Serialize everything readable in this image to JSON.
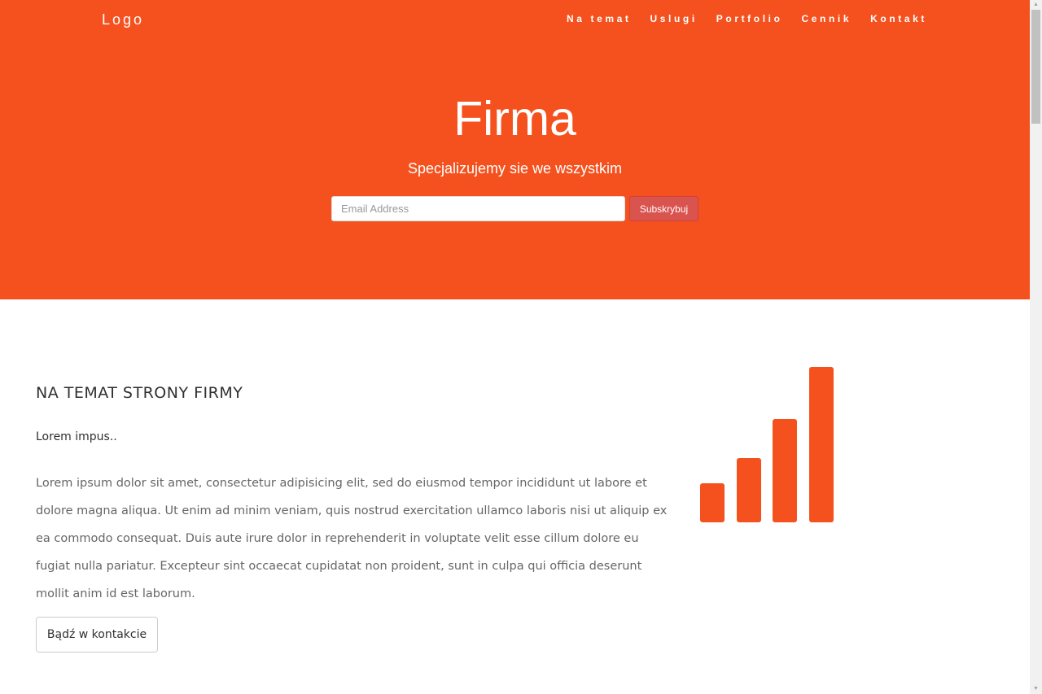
{
  "brand": {
    "logo": "Logo"
  },
  "nav": {
    "items": [
      "Na temat",
      "Uslugi",
      "Portfolio",
      "Cennik",
      "Kontakt"
    ]
  },
  "hero": {
    "title": "Firma",
    "subtitle": "Specjalizujemy sie we wszystkim",
    "email_placeholder": "Email Address",
    "subscribe_label": "Subskrybuj"
  },
  "about": {
    "heading": "NA TEMAT STRONY FIRMY",
    "lead": "Lorem impus..",
    "body": "Lorem ipsum dolor sit amet, consectetur adipisicing elit, sed do eiusmod tempor incididunt ut labore et dolore magna aliqua. Ut enim ad minim veniam, quis nostrud exercitation ullamco laboris nisi ut aliquip ex ea commodo consequat. Duis aute irure dolor in reprehenderit in voluptate velit esse cillum dolore eu fugiat nulla pariatur. Excepteur sint occaecat cupidatat non proident, sunt in culpa qui officia deserunt mollit anim id est laborum.",
    "contact_label": "Bądź w kontakcie"
  },
  "icons": {
    "signal": "signal-icon",
    "bar_levels": [
      1,
      2,
      3,
      4
    ]
  },
  "colors": {
    "brand": "#f4511e",
    "subscribe": "#d9534f"
  }
}
